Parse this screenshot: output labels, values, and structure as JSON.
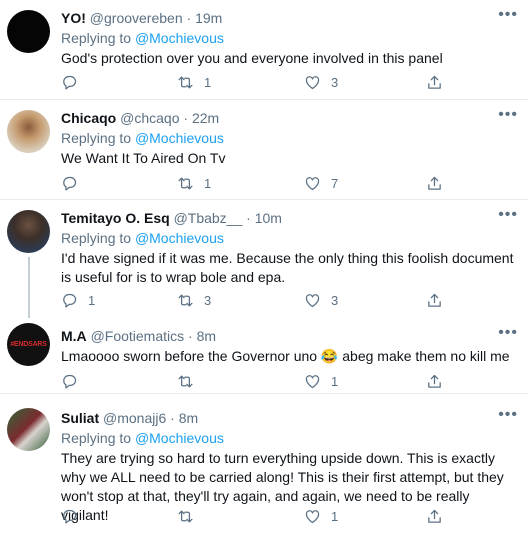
{
  "replying_label": "Replying to",
  "tweets": [
    {
      "name": "YO!",
      "handle": "@groovereben",
      "sep": "·",
      "time": "19m",
      "replying_to": "@Mochievous",
      "text": "God's protection over you and everyone involved in this panel",
      "replies": "",
      "retweets": "1",
      "likes": "3"
    },
    {
      "name": "Chicaqo",
      "handle": "@chcaqo",
      "sep": "·",
      "time": "22m",
      "replying_to": "@Mochievous",
      "text": "We Want It To Aired On Tv",
      "replies": "",
      "retweets": "1",
      "likes": "7"
    },
    {
      "name": "Temitayo O. Esq",
      "handle": "@Tbabz__",
      "sep": "·",
      "time": "10m",
      "replying_to": "@Mochievous",
      "text": "I'd have signed if it was me. Because the only thing this foolish document is useful for is to wrap bole and epa.",
      "replies": "1",
      "retweets": "3",
      "likes": "3"
    },
    {
      "name": "M.A",
      "handle": "@Footiematics",
      "sep": "·",
      "time": "8m",
      "avatar_text": "#ENDSARS",
      "text": "Lmaoooo sworn before the Governor uno 😂 abeg make them no kill me",
      "replies": "",
      "retweets": "",
      "likes": "1"
    },
    {
      "name": "Suliat",
      "handle": "@monajj6",
      "sep": "·",
      "time": "8m",
      "replying_to": "@Mochievous",
      "text": "They are trying so hard to turn everything upside down. This is exactly why we ALL need to be carried along! This is their first attempt, but they won't stop at that, they'll try again, and again, we need to be really vigilant!",
      "replies": "",
      "retweets": "",
      "likes": "1"
    }
  ]
}
